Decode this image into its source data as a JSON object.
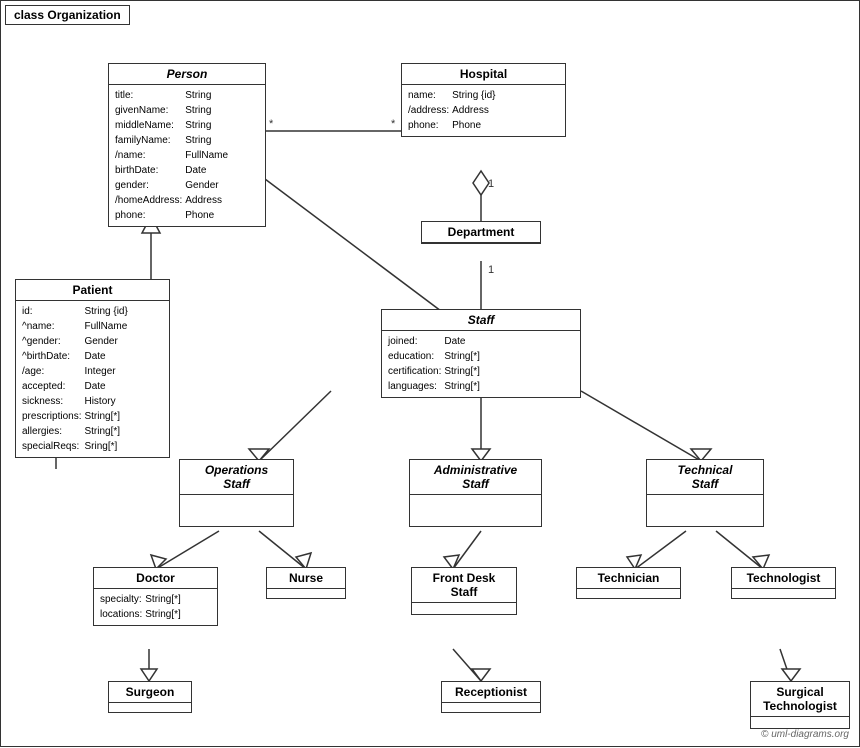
{
  "diagram": {
    "title": "class Organization",
    "classes": {
      "person": {
        "name": "Person",
        "italic": true,
        "attrs": [
          [
            "title:",
            "String"
          ],
          [
            "givenName:",
            "String"
          ],
          [
            "middleName:",
            "String"
          ],
          [
            "familyName:",
            "String"
          ],
          [
            "/name:",
            "FullName"
          ],
          [
            "birthDate:",
            "Date"
          ],
          [
            "gender:",
            "Gender"
          ],
          [
            "/homeAddress:",
            "Address"
          ],
          [
            "phone:",
            "Phone"
          ]
        ]
      },
      "hospital": {
        "name": "Hospital",
        "italic": false,
        "attrs": [
          [
            "name:",
            "String {id}"
          ],
          [
            "/address:",
            "Address"
          ],
          [
            "phone:",
            "Phone"
          ]
        ]
      },
      "patient": {
        "name": "Patient",
        "italic": false,
        "attrs": [
          [
            "id:",
            "String {id}"
          ],
          [
            "^name:",
            "FullName"
          ],
          [
            "^gender:",
            "Gender"
          ],
          [
            "^birthDate:",
            "Date"
          ],
          [
            "/age:",
            "Integer"
          ],
          [
            "accepted:",
            "Date"
          ],
          [
            "sickness:",
            "History"
          ],
          [
            "prescriptions:",
            "String[*]"
          ],
          [
            "allergies:",
            "String[*]"
          ],
          [
            "specialReqs:",
            "Sring[*]"
          ]
        ]
      },
      "department": {
        "name": "Department",
        "italic": false,
        "attrs": []
      },
      "staff": {
        "name": "Staff",
        "italic": true,
        "attrs": [
          [
            "joined:",
            "Date"
          ],
          [
            "education:",
            "String[*]"
          ],
          [
            "certification:",
            "String[*]"
          ],
          [
            "languages:",
            "String[*]"
          ]
        ]
      },
      "operations_staff": {
        "name": "Operations\nStaff",
        "italic": true,
        "attrs": []
      },
      "administrative_staff": {
        "name": "Administrative\nStaff",
        "italic": true,
        "attrs": []
      },
      "technical_staff": {
        "name": "Technical\nStaff",
        "italic": true,
        "attrs": []
      },
      "doctor": {
        "name": "Doctor",
        "italic": false,
        "attrs": [
          [
            "specialty:",
            "String[*]"
          ],
          [
            "locations:",
            "String[*]"
          ]
        ]
      },
      "nurse": {
        "name": "Nurse",
        "italic": false,
        "attrs": []
      },
      "front_desk_staff": {
        "name": "Front Desk\nStaff",
        "italic": false,
        "attrs": []
      },
      "technician": {
        "name": "Technician",
        "italic": false,
        "attrs": []
      },
      "technologist": {
        "name": "Technologist",
        "italic": false,
        "attrs": []
      },
      "surgeon": {
        "name": "Surgeon",
        "italic": false,
        "attrs": []
      },
      "receptionist": {
        "name": "Receptionist",
        "italic": false,
        "attrs": []
      },
      "surgical_technologist": {
        "name": "Surgical\nTechnologist",
        "italic": false,
        "attrs": []
      }
    },
    "copyright": "© uml-diagrams.org"
  }
}
